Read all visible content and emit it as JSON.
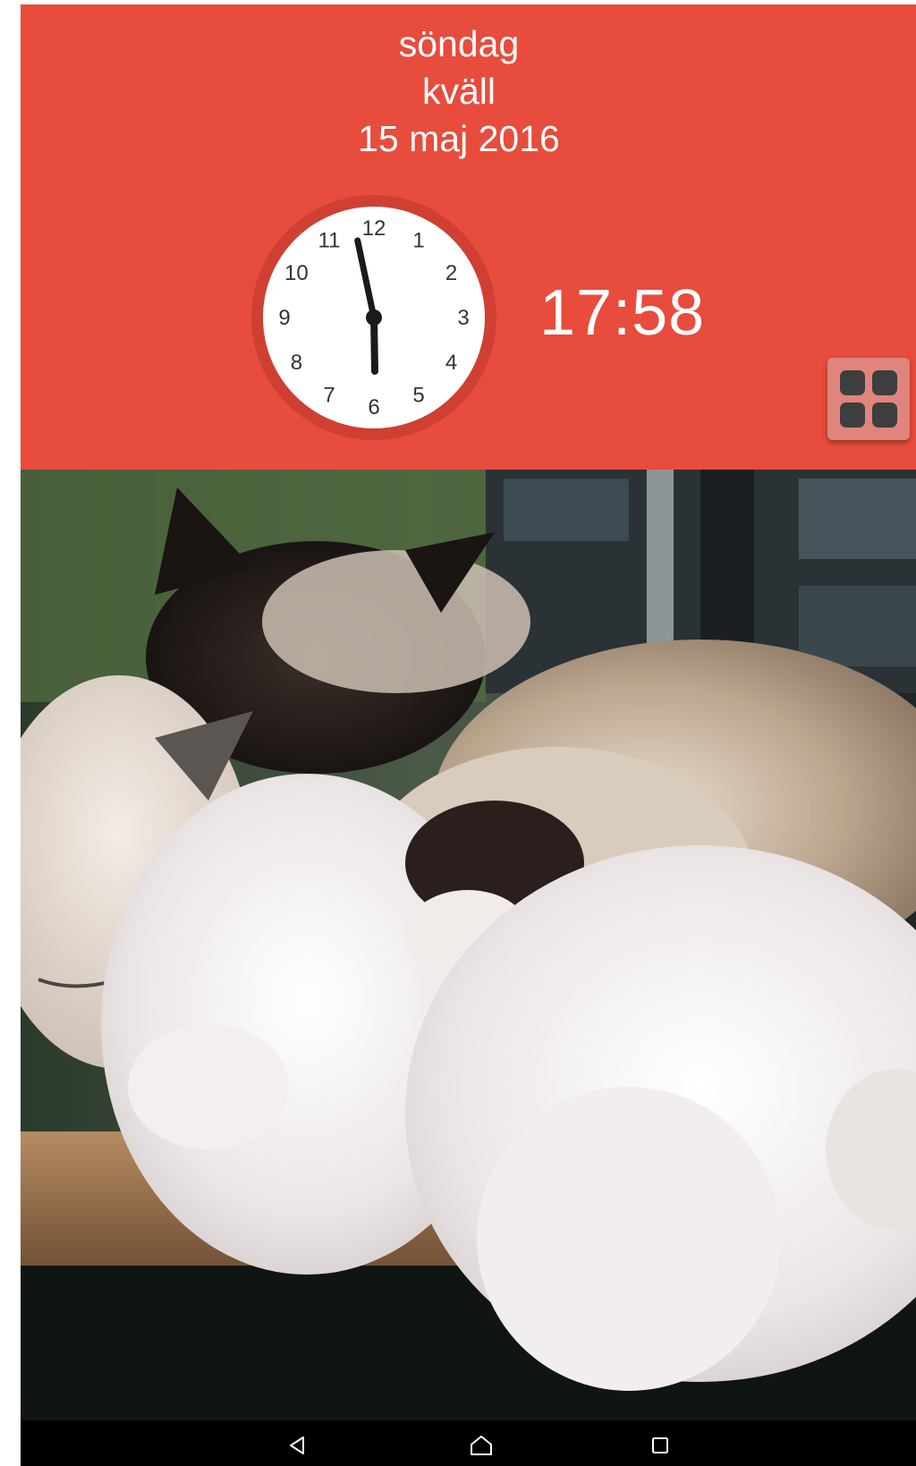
{
  "header": {
    "weekday": "söndag",
    "day_part": "kväll",
    "date": "15 maj 2016",
    "digital_time": "17:58",
    "background_color": "#e74c3c"
  },
  "analog_clock": {
    "hour": 17,
    "minute": 58,
    "numerals": [
      "12",
      "1",
      "2",
      "3",
      "4",
      "5",
      "6",
      "7",
      "8",
      "9",
      "10",
      "11"
    ]
  },
  "apps_button": {
    "icon": "grid-icon"
  },
  "photo": {
    "subject": "sleeping-cats-photo"
  },
  "navigation_bar": {
    "buttons": [
      "back-icon",
      "home-icon",
      "recents-icon"
    ]
  }
}
